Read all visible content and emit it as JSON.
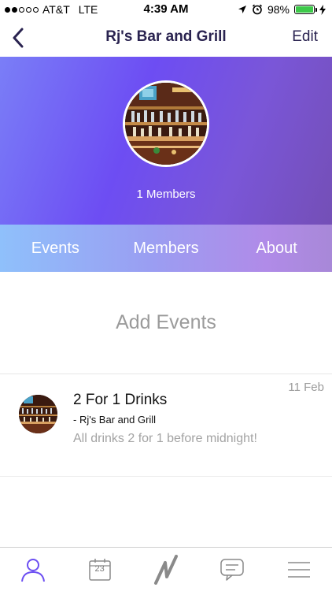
{
  "status_bar": {
    "carrier": "AT&T",
    "network": "LTE",
    "time": "4:39 AM",
    "battery": "98%",
    "battery_level": 0.98,
    "signal_bars_filled": 2,
    "signal_bars_total": 5
  },
  "nav": {
    "title": "Rj's Bar and Grill",
    "edit_label": "Edit",
    "back_icon": "chevron-left-icon"
  },
  "hero": {
    "members_text": "1 Members"
  },
  "tabs": [
    {
      "label": "Events"
    },
    {
      "label": "Members"
    },
    {
      "label": "About"
    }
  ],
  "add_events_label": "Add Events",
  "events": [
    {
      "title": "2 For 1 Drinks",
      "venue": "- Rj's Bar and Grill",
      "description": "All drinks 2 for 1 before midnight!",
      "date": "11 Feb"
    }
  ],
  "tab_bar": {
    "items": [
      "profile-icon",
      "calendar-icon",
      "activity-icon",
      "chat-icon",
      "menu-icon"
    ],
    "calendar_day": "23"
  },
  "colors": {
    "accent": "#6c4ff2",
    "title": "#2a2350"
  }
}
